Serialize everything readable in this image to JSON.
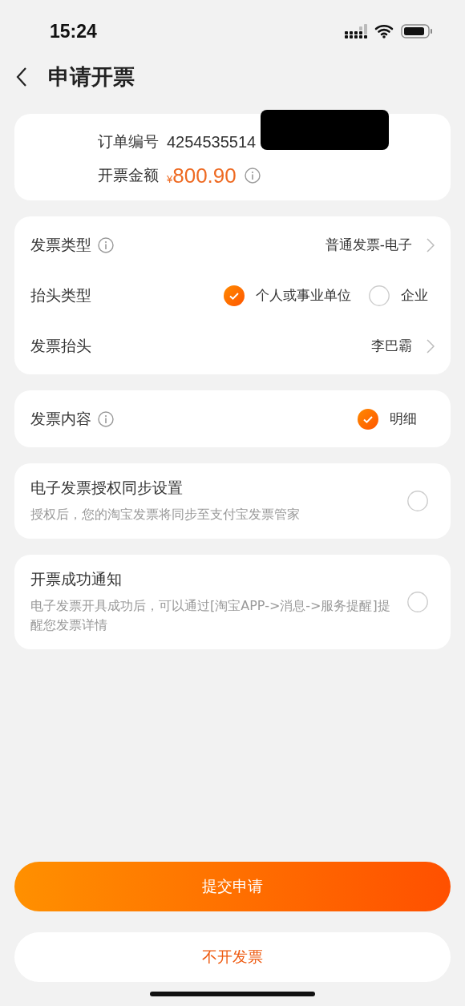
{
  "status_bar": {
    "time": "15:24"
  },
  "header": {
    "title": "申请开票"
  },
  "order": {
    "number_label": "订单编号",
    "number": "4254535514",
    "redacted": true,
    "amount_label": "开票金额",
    "currency": "¥",
    "amount": "800.90"
  },
  "invoice": [
    {
      "kind": "link",
      "label": "发票类型",
      "info": true,
      "value": "普通发票-电子"
    },
    {
      "kind": "radio",
      "label": "抬头类型",
      "options": [
        {
          "label": "个人或事业单位",
          "selected": true
        },
        {
          "label": "企业",
          "selected": false
        }
      ]
    },
    {
      "kind": "link",
      "label": "发票抬头",
      "info": false,
      "value": "李巴霸"
    }
  ],
  "content": {
    "label": "发票内容",
    "options": [
      {
        "label": "明细",
        "selected": true
      }
    ]
  },
  "toggles": [
    {
      "title": "电子发票授权同步设置",
      "description": "授权后，您的淘宝发票将同步至支付宝发票管家",
      "checked": false
    },
    {
      "title": "开票成功通知",
      "description": "电子发票开具成功后，可以通过[淘宝APP->消息->服务提醒]提醒您发票详情",
      "checked": false
    }
  ],
  "buttons": {
    "primary": "提交申请",
    "secondary": "不开发票"
  }
}
